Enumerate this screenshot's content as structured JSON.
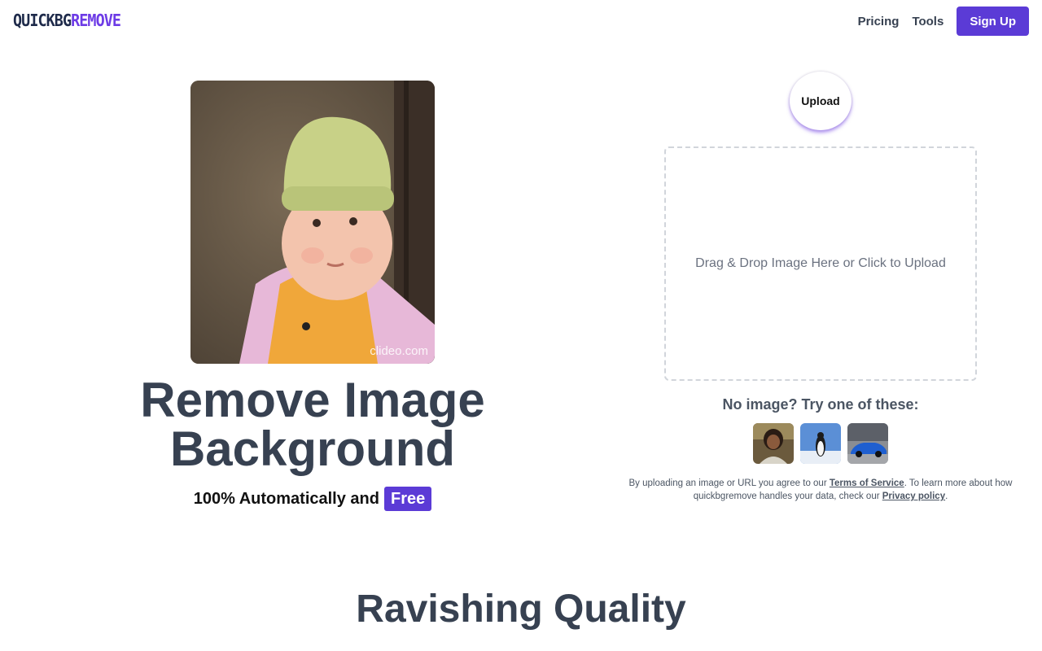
{
  "header": {
    "logo_part1": "QUICKBG",
    "logo_part2": "REMOVE",
    "nav": [
      {
        "label": "Pricing"
      },
      {
        "label": "Tools"
      }
    ],
    "signup_label": "Sign Up"
  },
  "hero": {
    "image_watermark": "clideo.com",
    "title_line1": "Remove Image",
    "title_line2": "Background",
    "subtitle": "100% Automatically and",
    "badge": "Free"
  },
  "upload": {
    "button_label": "Upload",
    "dropzone_text": "Drag & Drop Image Here or Click to Upload",
    "samples_title": "No image? Try one of these:",
    "samples": [
      {
        "icon": "person-thumbnail"
      },
      {
        "icon": "penguin-thumbnail"
      },
      {
        "icon": "car-thumbnail"
      }
    ],
    "legal_prefix": "By uploading an image or URL you agree to our",
    "terms_link": "Terms of Service",
    "legal_middle": ". To learn more about how quickbgremove handles your data, check our",
    "privacy_link": "Privacy policy",
    "legal_suffix": "."
  },
  "section": {
    "title": "Ravishing Quality"
  },
  "colors": {
    "brand_dark": "#1e2a4a",
    "brand_purple": "#6d3be6",
    "button_purple": "#5b3bd6",
    "text": "#374151"
  }
}
